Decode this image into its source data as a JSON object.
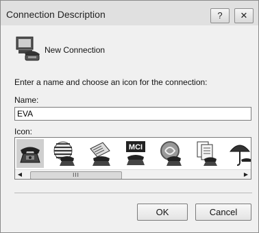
{
  "window": {
    "title": "Connection Description",
    "help_button": "?",
    "close_button": "✕"
  },
  "header": {
    "label": "New Connection"
  },
  "instructions": "Enter a name and choose an icon for the connection:",
  "name": {
    "label": "Name:",
    "value": "EVA"
  },
  "icon": {
    "label": "Icon:",
    "items": [
      "phone-icon",
      "globe-phone-icon",
      "fax-phone-icon",
      "mci-phone-icon",
      "ge-phone-icon",
      "documents-phone-icon",
      "umbrella-phone-icon"
    ],
    "selected_index": 0,
    "mci_text": "MCI",
    "scroll_thumb": "III"
  },
  "buttons": {
    "ok": "OK",
    "cancel": "Cancel"
  }
}
